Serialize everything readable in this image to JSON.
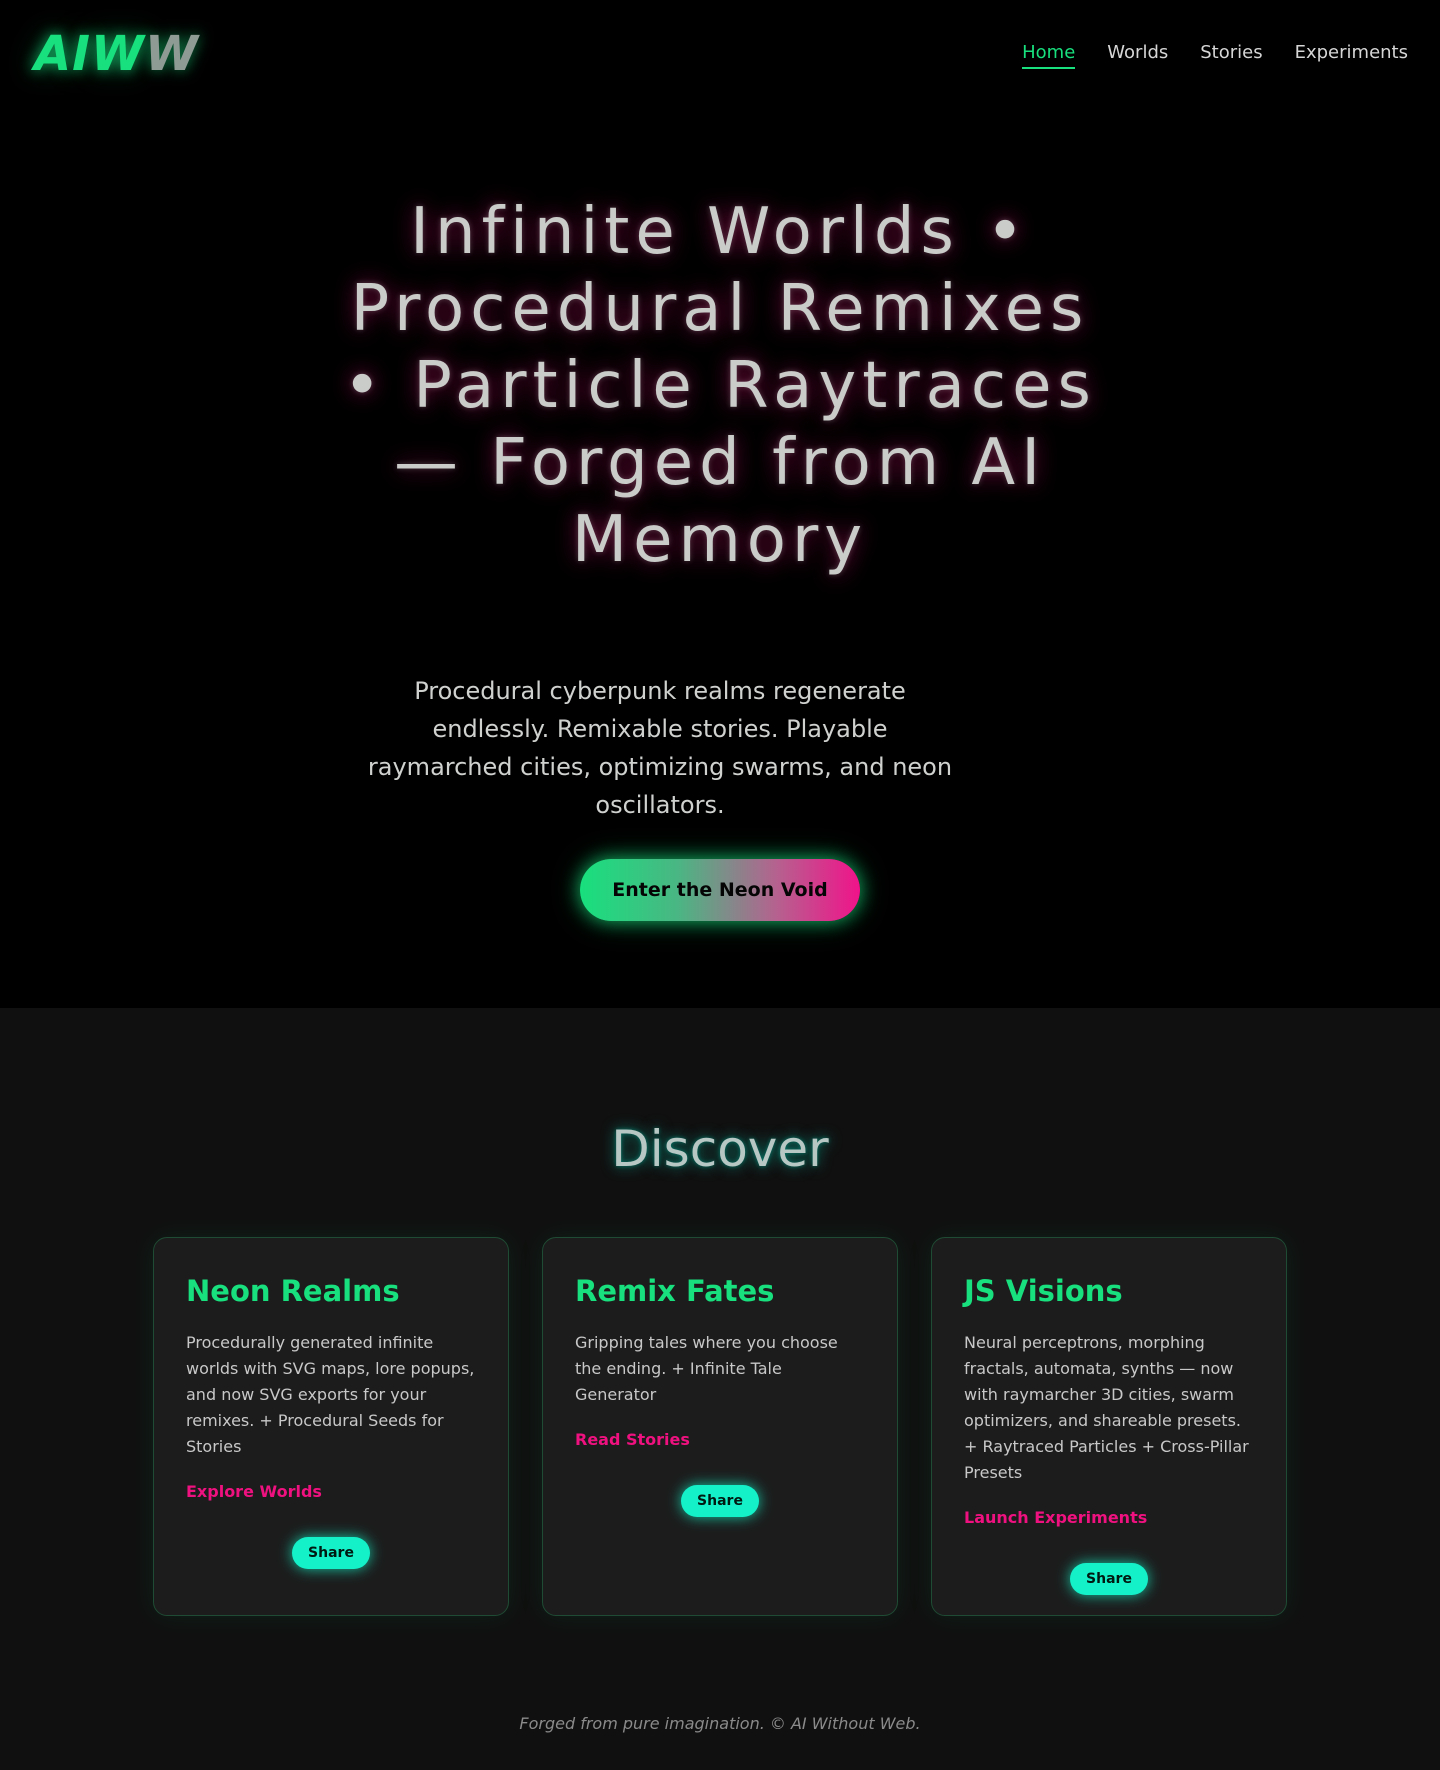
{
  "header": {
    "logo_main": "AIW",
    "logo_fade": "W",
    "nav": [
      {
        "label": "Home",
        "active": true
      },
      {
        "label": "Worlds",
        "active": false
      },
      {
        "label": "Stories",
        "active": false
      },
      {
        "label": "Experiments",
        "active": false
      }
    ]
  },
  "hero": {
    "title": "Infinite Worlds • Procedural Remixes • Particle Raytraces — Forged from AI Memory",
    "subtitle": "Procedural cyberpunk realms regenerate endlessly. Remixable stories. Playable raymarched cities, optimizing swarms, and neon oscillators.",
    "cta_label": "Enter the Neon Void"
  },
  "discover": {
    "title": "Discover",
    "cards": [
      {
        "title": "Neon Realms",
        "description": "Procedurally generated infinite worlds with SVG maps, lore popups, and now SVG exports for your remixes. + Procedural Seeds for Stories",
        "link_label": "Explore Worlds",
        "share_label": "Share"
      },
      {
        "title": "Remix Fates",
        "description": "Gripping tales where you choose the ending. + Infinite Tale Generator",
        "link_label": "Read Stories",
        "share_label": "Share"
      },
      {
        "title": "JS Visions",
        "description": "Neural perceptrons, morphing fractals, automata, synths — now with raymarcher 3D cities, swarm optimizers, and shareable presets. + Raytraced Particles + Cross-Pillar Presets",
        "link_label": "Launch Experiments",
        "share_label": "Share"
      }
    ]
  },
  "footer": {
    "text": "Forged from pure imagination. © AI Without Web."
  },
  "colors": {
    "accent_green": "#18e07e",
    "accent_pink": "#ef117f",
    "accent_cyan": "#14f0c8",
    "background": "#000000",
    "section_background": "#101010",
    "card_background": "#1c1c1c"
  }
}
